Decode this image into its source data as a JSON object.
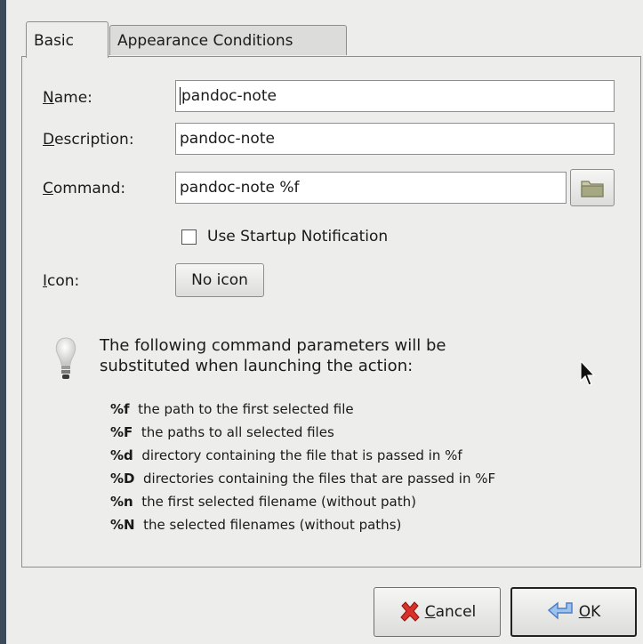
{
  "window": {
    "tabs": {
      "basic": "Basic",
      "appearance": "Appearance Conditions"
    }
  },
  "form": {
    "name_mnemonic": "N",
    "name_rest": "ame:",
    "name_value": "pandoc-note",
    "description_mnemonic": "D",
    "description_rest": "escription:",
    "description_value": "pandoc-note",
    "command_mnemonic": "C",
    "command_rest": "ommand:",
    "command_value": "pandoc-note %f",
    "startup_label": "Use Startup Notification",
    "startup_checked": false,
    "icon_mnemonic": "I",
    "icon_rest": "con:",
    "icon_button": "No icon"
  },
  "info": {
    "line1": "The following command parameters will be",
    "line2": "substituted when launching the action:",
    "params": [
      {
        "code": "%f",
        "desc": "the path to the first selected file"
      },
      {
        "code": "%F",
        "desc": "the paths to all selected files"
      },
      {
        "code": "%d",
        "desc": "directory containing the file that is passed in %f"
      },
      {
        "code": "%D",
        "desc": "directories containing the files that are passed in %F"
      },
      {
        "code": "%n",
        "desc": "the first selected filename (without path)"
      },
      {
        "code": "%N",
        "desc": "the selected filenames (without paths)"
      }
    ]
  },
  "footer": {
    "cancel_mnemonic": "C",
    "cancel_rest": "ancel",
    "ok_mnemonic": "O",
    "ok_rest": "K"
  },
  "icons": {
    "folder": "folder-icon",
    "bulb": "lightbulb-icon",
    "cancel": "cancel-icon",
    "ok": "ok-icon",
    "cursor": "mouse-cursor-icon"
  },
  "colors": {
    "cancel_red": "#d9302a",
    "ok_blue": "#4a7fc9",
    "folder": "#a5a883"
  }
}
